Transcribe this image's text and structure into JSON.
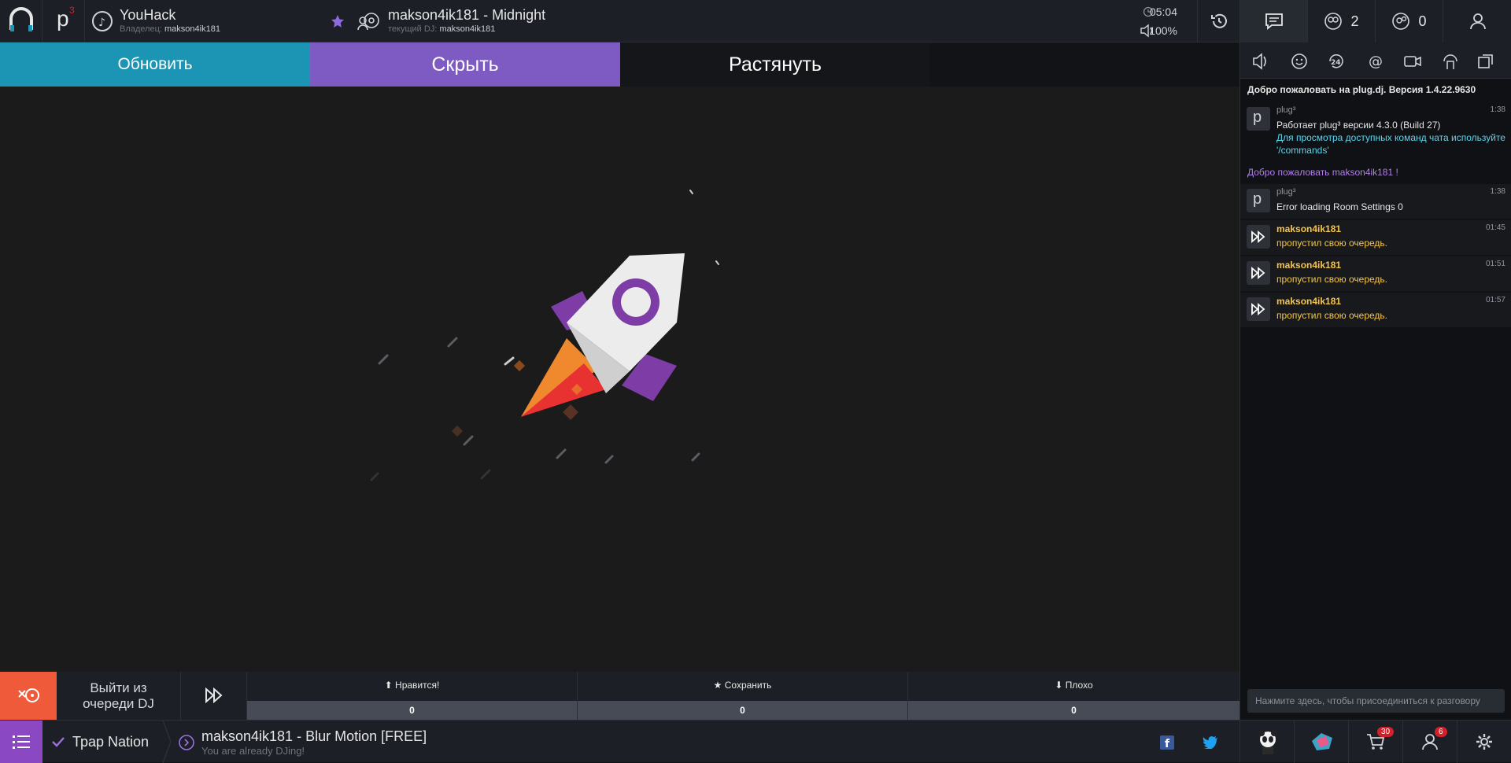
{
  "topbar": {
    "room_name": "YouHack",
    "owner_label": "Владелец:",
    "owner_name": "makson4ik181",
    "dj_title": "makson4ik181 - Midnight",
    "current_dj_label": "текущий DJ:",
    "current_dj": "makson4ik181",
    "time": "05:04",
    "volume": "100%",
    "p3_sup": "3"
  },
  "actions": {
    "refresh": "Обновить",
    "hide": "Скрыть",
    "stretch": "Растянуть"
  },
  "bottom": {
    "leave_line1": "Выйти из",
    "leave_line2": "очереди DJ",
    "woot": {
      "label": "Нравится!",
      "count": "0"
    },
    "grab": {
      "label": "Сохранить",
      "count": "0"
    },
    "meh": {
      "label": "Плохо",
      "count": "0"
    },
    "playlist": "Трар Nation",
    "now_title": "makson4ik181 - Blur Motion [FREE]",
    "now_sub": "You are already DJing!"
  },
  "right": {
    "tabs": {
      "users_count": "2",
      "waitlist_count": "0"
    },
    "chat": {
      "welcome": "Добро пожаловать на plug.dj. Версия 1.4.22.9630",
      "m1_from": "plug³",
      "m1_time": "1:38",
      "m1_line1": "Работает plug³ версии 4.3.0 (Build 27)",
      "m1_line2": "Для просмотра доступных команд чата используйте",
      "m1_line3": "'/commands'",
      "welcome_user": "Добро пожаловать makson4ik181 !",
      "m2_from": "plug³",
      "m2_time": "1:38",
      "m2_line1": "Error loading Room Settings 0",
      "skips": [
        {
          "user": "makson4ik181",
          "time": "01:45",
          "text": "пропустил свою очередь."
        },
        {
          "user": "makson4ik181",
          "time": "01:51",
          "text": "пропустил свою очередь."
        },
        {
          "user": "makson4ik181",
          "time": "01:57",
          "text": "пропустил свою очередь."
        }
      ],
      "input_placeholder": "Нажмите здесь, чтобы присоединиться к разговору"
    },
    "footer": {
      "shop_badge": "30",
      "profile_badge": "6"
    }
  },
  "colors": {
    "accent_blue": "#1b95b3",
    "accent_purple": "#7e5bc2",
    "leave_orange": "#ef5a3a",
    "skip_yellow": "#f7c646",
    "purple_msg": "#b37feb",
    "cyan_msg": "#5ad7f0"
  }
}
